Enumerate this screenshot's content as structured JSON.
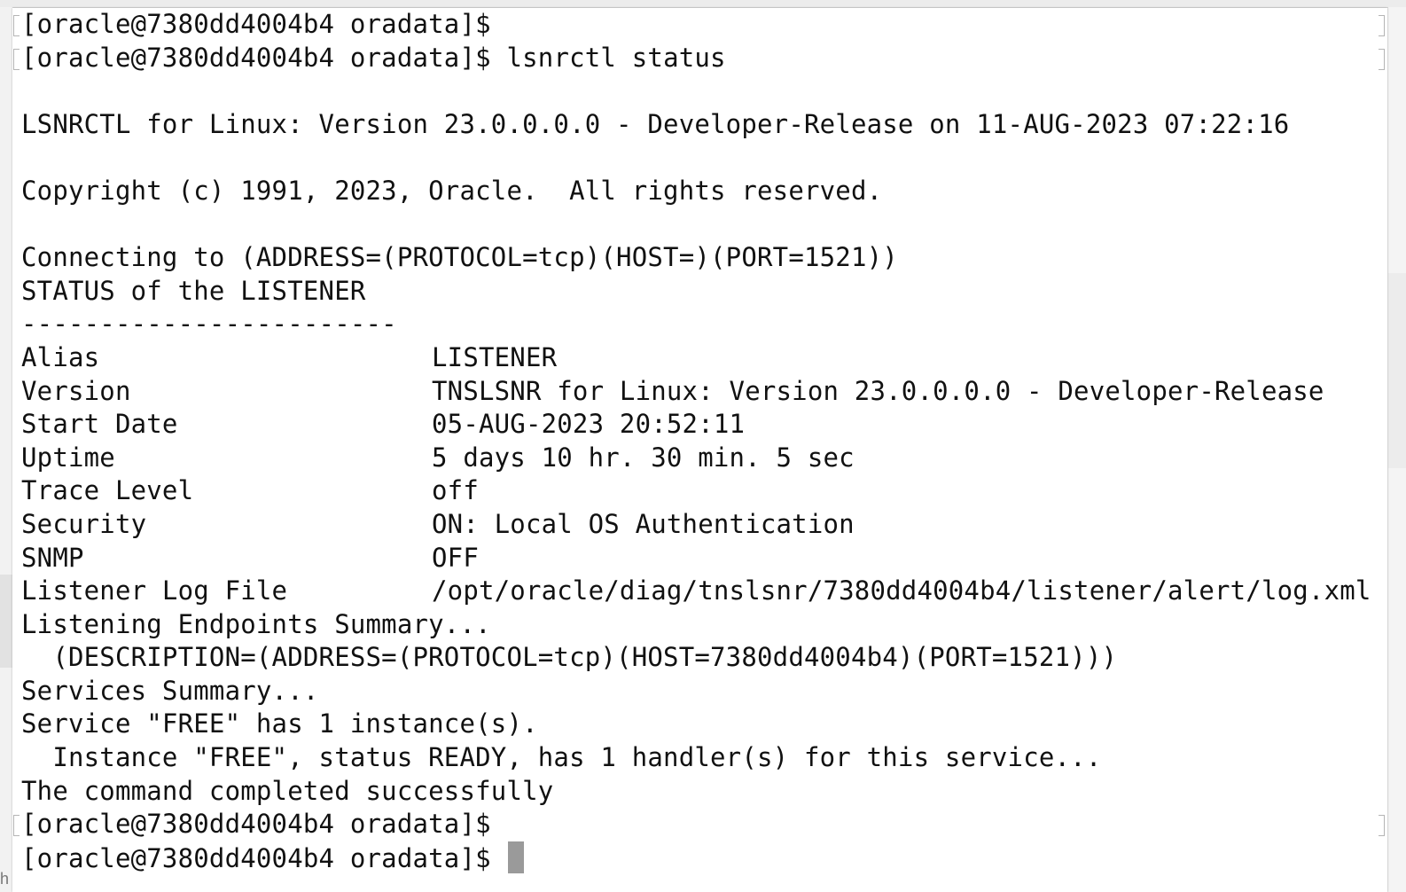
{
  "terminal": {
    "prompt": "[oracle@7380dd4004b4 oradata]$",
    "command": "lsnrctl status",
    "header_line": "LSNRCTL for Linux: Version 23.0.0.0.0 - Developer-Release on 11-AUG-2023 07:22:16",
    "copyright_line": "Copyright (c) 1991, 2023, Oracle.  All rights reserved.",
    "connecting_line": "Connecting to (ADDRESS=(PROTOCOL=tcp)(HOST=)(PORT=1521))",
    "status_heading": "STATUS of the LISTENER",
    "separator": "------------------------",
    "status_rows": [
      {
        "label": "Alias",
        "value": "LISTENER"
      },
      {
        "label": "Version",
        "value": "TNSLSNR for Linux: Version 23.0.0.0.0 - Developer-Release"
      },
      {
        "label": "Start Date",
        "value": "05-AUG-2023 20:52:11"
      },
      {
        "label": "Uptime",
        "value": "5 days 10 hr. 30 min. 5 sec"
      },
      {
        "label": "Trace Level",
        "value": "off"
      },
      {
        "label": "Security",
        "value": "ON: Local OS Authentication"
      },
      {
        "label": "SNMP",
        "value": "OFF"
      },
      {
        "label": "Listener Log File",
        "value": "/opt/oracle/diag/tnslsnr/7380dd4004b4/listener/alert/log.xml"
      }
    ],
    "endpoints_heading": "Listening Endpoints Summary...",
    "endpoint": "  (DESCRIPTION=(ADDRESS=(PROTOCOL=tcp)(HOST=7380dd4004b4)(PORT=1521)))",
    "services_heading": "Services Summary...",
    "service_line": "Service \"FREE\" has 1 instance(s).",
    "instance_line": "  Instance \"FREE\", status READY, has 1 handler(s) for this service...",
    "completion_line": "The command completed successfully"
  },
  "background_fragment": "h"
}
